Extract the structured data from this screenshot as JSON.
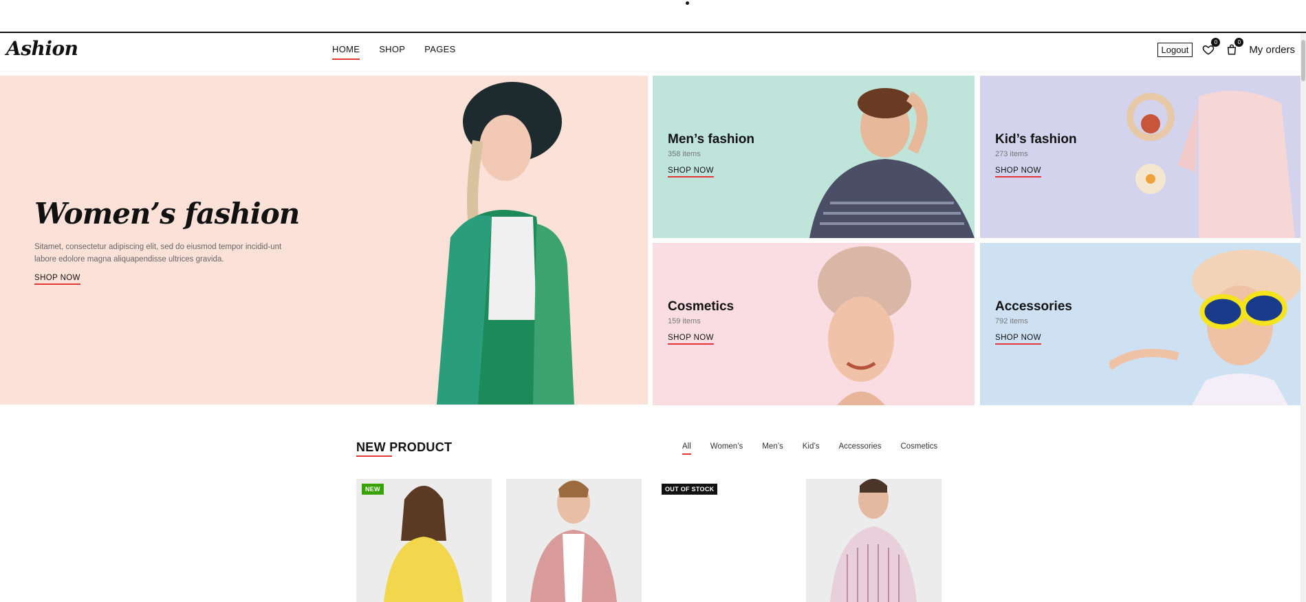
{
  "header": {
    "logo": "Ashion",
    "nav": [
      "HOME",
      "SHOP",
      "PAGES"
    ],
    "logout_label": "Logout",
    "wishlist_count": "0",
    "cart_count": "0",
    "my_orders_label": "My orders"
  },
  "hero": {
    "main": {
      "title": "Women’s fashion",
      "description": "Sitamet, consectetur adipiscing elit, sed do eiusmod tempor incidid-unt labore edolore magna aliquapendisse ultrices gravida.",
      "cta": "SHOP NOW"
    },
    "tiles": [
      {
        "title": "Men’s fashion",
        "count": "358 items",
        "cta": "SHOP NOW"
      },
      {
        "title": "Kid’s fashion",
        "count": "273 items",
        "cta": "SHOP NOW"
      },
      {
        "title": "Cosmetics",
        "count": "159 items",
        "cta": "SHOP NOW"
      },
      {
        "title": "Accessories",
        "count": "792 items",
        "cta": "SHOP NOW"
      }
    ]
  },
  "new_product": {
    "title": "NEW PRODUCT",
    "filters": [
      "All",
      "Women’s",
      "Men’s",
      "Kid’s",
      "Accessories",
      "Cosmetics"
    ],
    "labels": {
      "new": "NEW",
      "out_of_stock": "OUT OF STOCK"
    }
  },
  "colors": {
    "accent": "#e53637",
    "hero_women_bg": "#fce1d8",
    "men_bg": "#bfe4da",
    "kids_bg": "#d4d3ee",
    "cosmetics_bg": "#fadce3",
    "accessories_bg": "#cde1f3",
    "new_badge": "#36a300"
  }
}
